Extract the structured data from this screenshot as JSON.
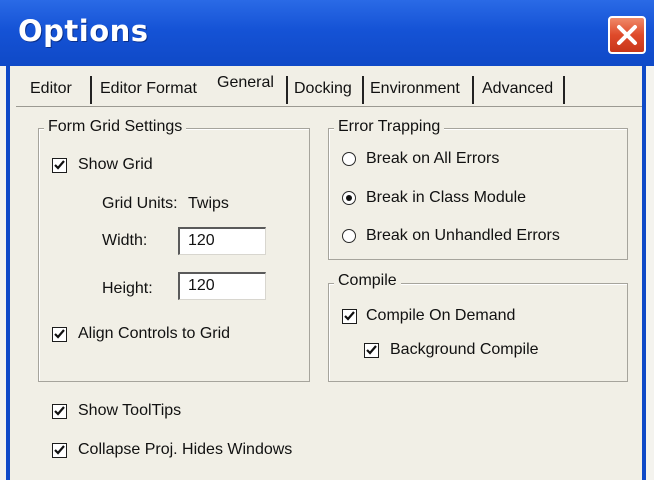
{
  "window": {
    "title": "Options"
  },
  "tabs": [
    {
      "label": "Editor"
    },
    {
      "label": "Editor Format"
    },
    {
      "label": "General",
      "active": true
    },
    {
      "label": "Docking"
    },
    {
      "label": "Environment"
    },
    {
      "label": "Advanced"
    }
  ],
  "form_grid": {
    "label": "Form Grid Settings",
    "show_grid": {
      "label": "Show Grid",
      "checked": true
    },
    "grid_units_label": "Grid Units:",
    "grid_units_value": "Twips",
    "width_label": "Width:",
    "width_value": "120",
    "height_label": "Height:",
    "height_value": "120",
    "align_controls": {
      "label": "Align Controls to Grid",
      "checked": true
    }
  },
  "error_trapping": {
    "label": "Error Trapping",
    "options": [
      {
        "label": "Break on All Errors",
        "selected": false
      },
      {
        "label": "Break in Class Module",
        "selected": true
      },
      {
        "label": "Break on Unhandled Errors",
        "selected": false
      }
    ]
  },
  "compile": {
    "label": "Compile",
    "on_demand": {
      "label": "Compile On Demand",
      "checked": true
    },
    "background": {
      "label": "Background Compile",
      "checked": true
    }
  },
  "misc": {
    "show_tooltips": {
      "label": "Show ToolTips",
      "checked": true
    },
    "collapse_proj": {
      "label": "Collapse Proj. Hides Windows",
      "checked": true
    }
  },
  "colors": {
    "titlebar": "#1553d6",
    "close": "#df4a2a",
    "dialog_bg": "#f1efe6"
  }
}
